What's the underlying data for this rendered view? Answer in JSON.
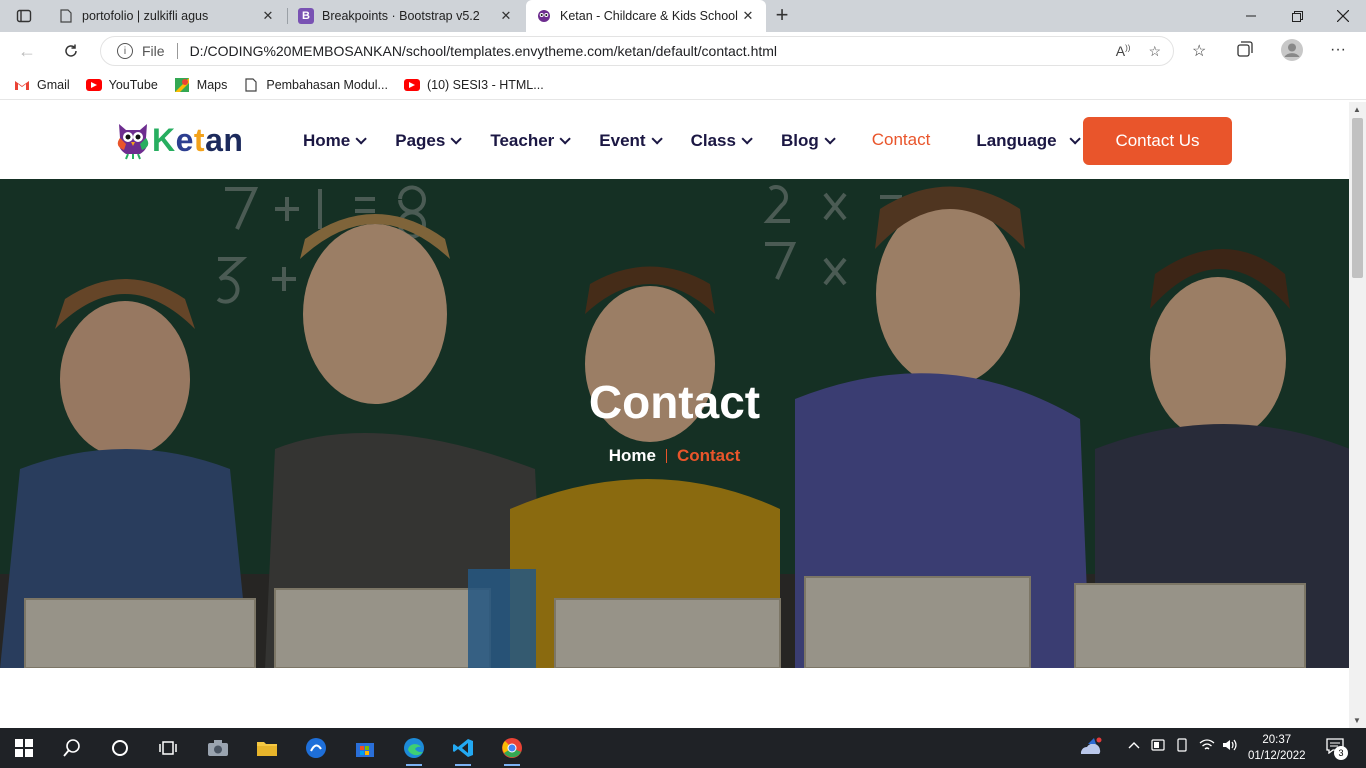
{
  "browser": {
    "tabs": [
      {
        "title": "portofolio | zulkifli agus",
        "active": false,
        "icon": "page-icon"
      },
      {
        "title": "Breakpoints · Bootstrap v5.2",
        "active": false,
        "icon": "bootstrap-icon"
      },
      {
        "title": "Ketan - Childcare & Kids School",
        "active": true,
        "icon": "ketan-owl-icon"
      }
    ],
    "address": {
      "scheme_label": "File",
      "url": "D:/CODING%20MEMBOSANKAN/school/templates.envytheme.com/ketan/default/contact.html"
    },
    "bookmarks": [
      {
        "label": "Gmail",
        "icon": "gmail-icon"
      },
      {
        "label": "YouTube",
        "icon": "youtube-icon"
      },
      {
        "label": "Maps",
        "icon": "maps-icon"
      },
      {
        "label": "Pembahasan Modul...",
        "icon": "page-icon"
      },
      {
        "label": "(10) SESI3 - HTML...",
        "icon": "youtube-icon"
      }
    ]
  },
  "site": {
    "logo_text": {
      "k": "K",
      "e": "e",
      "t": "t",
      "a": "a",
      "n": "n"
    },
    "nav": [
      {
        "label": "Home",
        "has_dropdown": true
      },
      {
        "label": "Pages",
        "has_dropdown": true
      },
      {
        "label": "Teacher",
        "has_dropdown": true
      },
      {
        "label": "Event",
        "has_dropdown": true
      },
      {
        "label": "Class",
        "has_dropdown": true
      },
      {
        "label": "Blog",
        "has_dropdown": true
      },
      {
        "label": "Contact",
        "has_dropdown": false,
        "active": true
      },
      {
        "label": "Language",
        "has_dropdown": true
      }
    ],
    "cta_label": "Contact Us",
    "colors": {
      "accent": "#e9552b",
      "nav_text": "#1b1743"
    },
    "hero": {
      "title": "Contact",
      "breadcrumb_home": "Home",
      "breadcrumb_current": "Contact"
    }
  },
  "taskbar": {
    "time": "20:37",
    "date": "01/12/2022",
    "notifications": "3"
  }
}
